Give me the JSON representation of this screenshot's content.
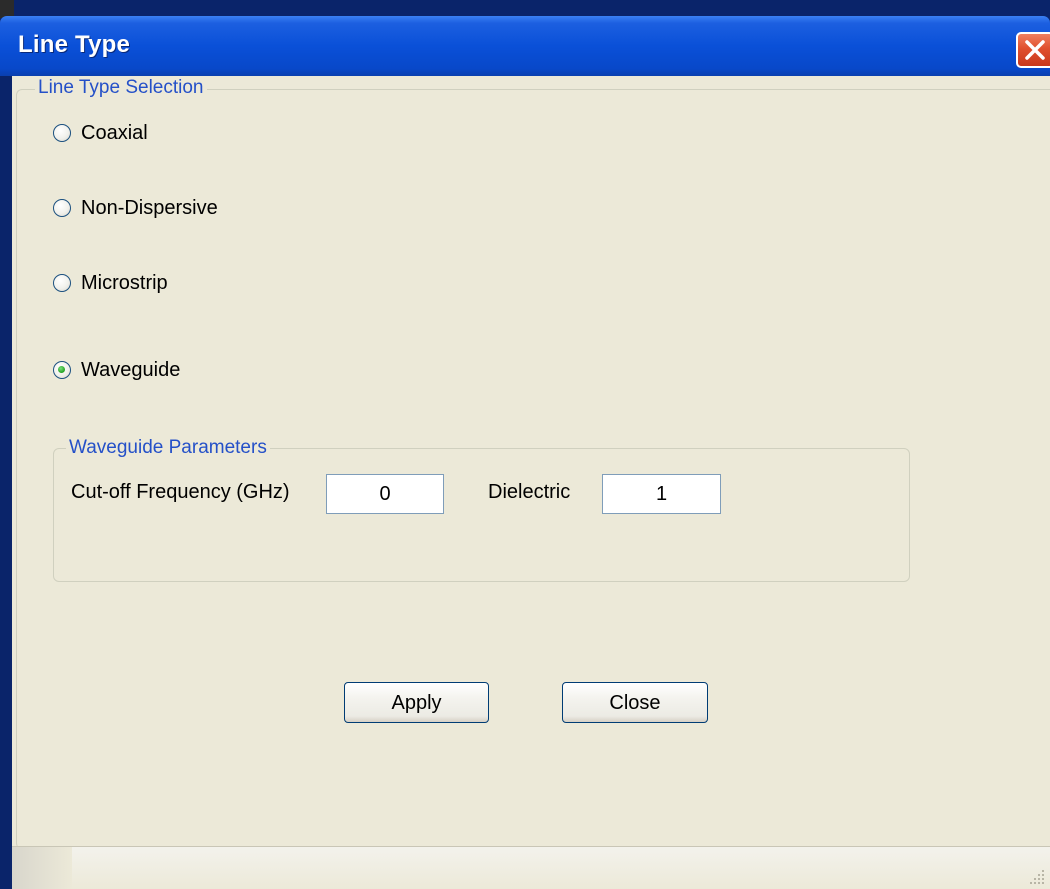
{
  "window": {
    "title": "Line Type"
  },
  "line_type_selection": {
    "legend": "Line Type Selection",
    "options": [
      {
        "label": "Coaxial",
        "checked": false
      },
      {
        "label": "Non-Dispersive",
        "checked": false
      },
      {
        "label": "Microstrip",
        "checked": false
      },
      {
        "label": "Waveguide",
        "checked": true
      }
    ]
  },
  "waveguide_parameters": {
    "legend": "Waveguide Parameters",
    "cutoff_label": "Cut-off Frequency (GHz)",
    "cutoff_value": "0",
    "dielectric_label": "Dielectric",
    "dielectric_value": "1"
  },
  "buttons": {
    "apply_label": "Apply",
    "close_label": "Close"
  },
  "colors": {
    "titlebar": "#0a50d8",
    "client_background": "#ece9d8",
    "group_legend_text": "#2450c8",
    "radio_checked_dot": "#21a121",
    "close_button": "#e0502e"
  }
}
